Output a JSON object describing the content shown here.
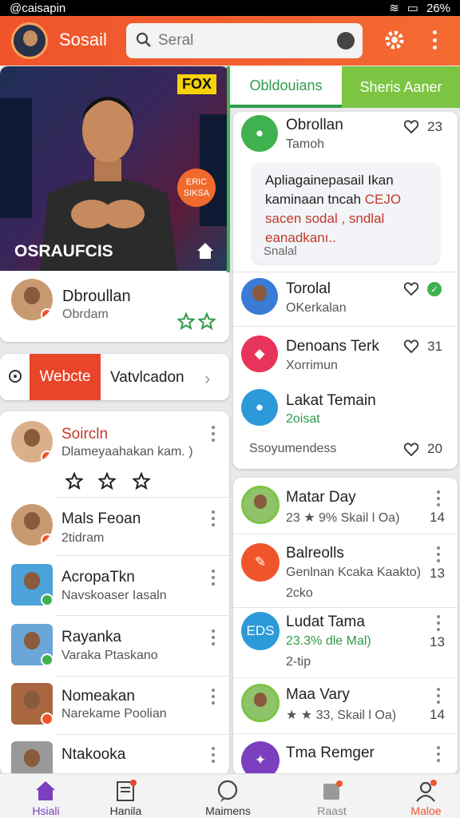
{
  "status": {
    "left": "@caisapin",
    "right": "26%"
  },
  "appbar": {
    "title": "Sosail",
    "search_placeholder": "Seral"
  },
  "hero": {
    "caption": "OSRAUFCIS",
    "logo": "FOX",
    "badge": "ERIC SIKSA"
  },
  "profile": {
    "name": "Dbroullan",
    "sub": "Obrdam"
  },
  "web": {
    "button": "Webcte",
    "text": "Vatvlcadon"
  },
  "left_list": [
    {
      "title": "Soircln",
      "sub": "Dlameyaahakan kam. )",
      "accent": "#c0392b"
    },
    {
      "title": "Mals Feoan",
      "sub": "2tidram"
    },
    {
      "title": "AcropaTkn",
      "sub": "Navskoaser Iasaln"
    },
    {
      "title": "Rayanka",
      "sub": "Varaka Ptaskano"
    },
    {
      "title": "Nomeakan",
      "sub": "Narekame Poolian"
    },
    {
      "title": "Ntakooka",
      "sub": ""
    }
  ],
  "tabs": [
    "Obldouians",
    "Sheris Aaner"
  ],
  "right_top": {
    "item1": {
      "title": "Obrollan",
      "sub": "Tamoh",
      "count": "23"
    },
    "bubble": [
      "Apliagainepasail Ikan",
      "kaminaan tncah",
      "CEJO",
      "sacen sodal , sndlal",
      "eanadkanı..",
      "Snalal"
    ],
    "item2": {
      "title": "Torolal",
      "sub": "OKerkalan"
    },
    "item3": {
      "title": "Denoans Terk",
      "sub": "Xorrimun",
      "count": "31"
    },
    "item4": {
      "title": "Lakat Temain",
      "sub": "2oisat"
    },
    "footer": {
      "text": "Ssoyumendess",
      "count": "20"
    }
  },
  "right_list": [
    {
      "title": "Matar Day",
      "sub": "23 ★ 9% Skail l Oa)",
      "count": "14"
    },
    {
      "title": "Balreolls",
      "sub": "Genlnan Kcaka Kaakto)",
      "sub2": "2cko",
      "count": "13"
    },
    {
      "title": "Ludat Tama",
      "sub": "23.3% dle Mal)",
      "sub2": "2-tip",
      "count": "13",
      "badge": "EDS"
    },
    {
      "title": "Maa Vary",
      "sub": "★ ★ 33, Skail l Oa)",
      "count": "14"
    },
    {
      "title": "Tma Remger",
      "sub": ""
    }
  ],
  "nav": [
    "Hsiali",
    "Hanila",
    "Maimens",
    "Raast",
    "Maloe"
  ],
  "colors": {
    "accent": "#f0542b",
    "green": "#3fb24f",
    "lime": "#7cc542",
    "purple": "#7b3fbf"
  }
}
